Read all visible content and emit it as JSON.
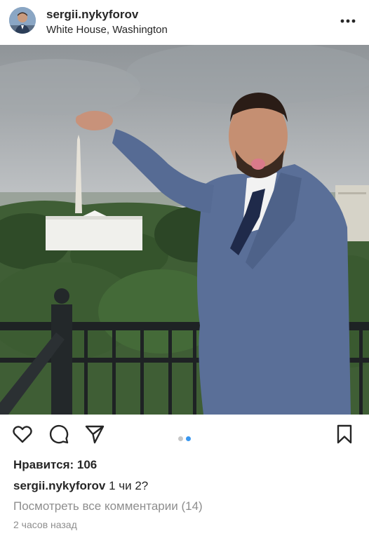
{
  "post": {
    "username": "sergii.nykyforov",
    "location": "White House, Washington",
    "likes_text": "Нравится: 106",
    "caption_user": "sergii.nykyforov",
    "caption_text": "1 чи 2?",
    "view_comments": "Посмотреть все комментарии (14)",
    "timestamp": "2 часов назад",
    "carousel": {
      "count": 2,
      "active": 2
    }
  },
  "icons": {
    "header": "more-dots-icon",
    "actions": [
      "heart-icon",
      "comment-icon",
      "share-icon",
      "bookmark-icon"
    ]
  },
  "colors": {
    "text": "#262626",
    "secondary": "#8e8e8e",
    "dot_active": "#3897f0",
    "dot_inactive": "#c7c7c7"
  }
}
